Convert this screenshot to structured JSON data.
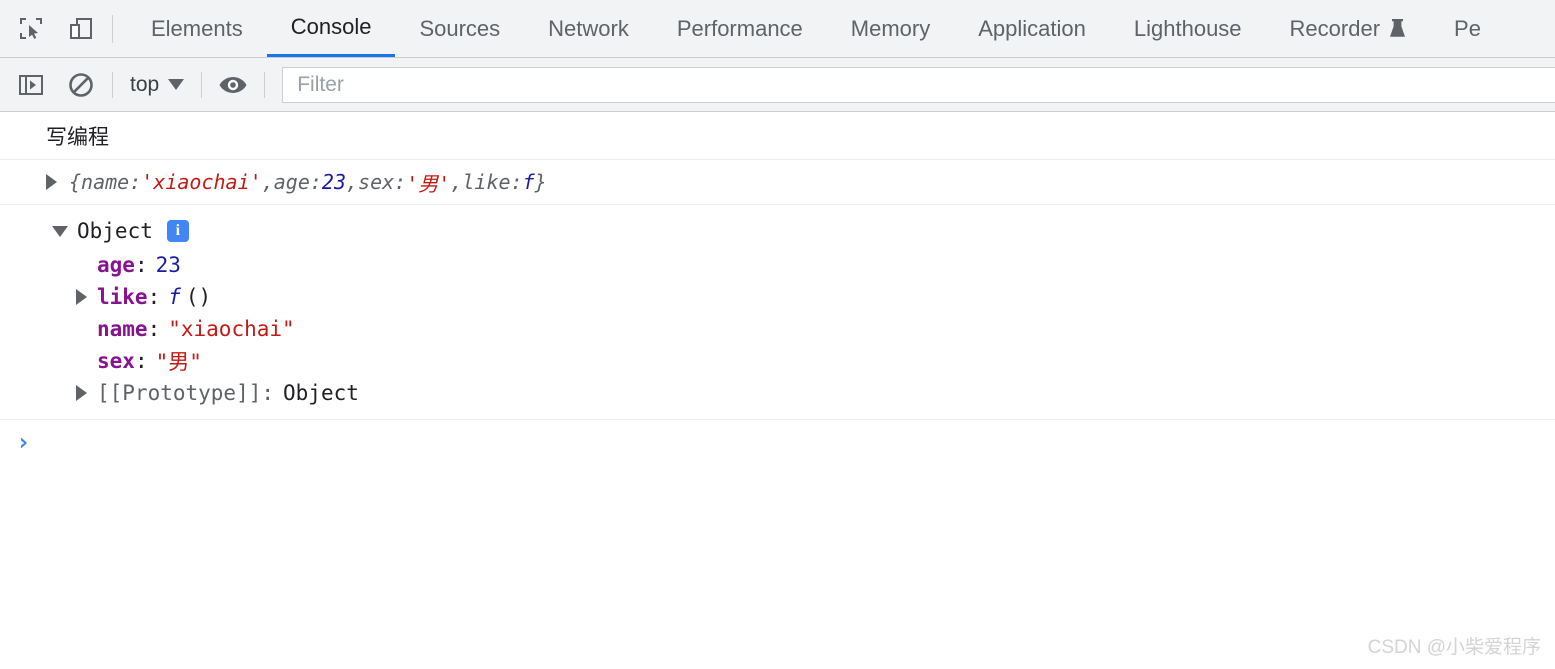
{
  "tabbar": {
    "icons": [
      {
        "name": "inspect-element-icon"
      },
      {
        "name": "device-toolbar-icon"
      }
    ],
    "tabs": [
      {
        "label": "Elements",
        "active": false
      },
      {
        "label": "Console",
        "active": true
      },
      {
        "label": "Sources",
        "active": false
      },
      {
        "label": "Network",
        "active": false
      },
      {
        "label": "Performance",
        "active": false
      },
      {
        "label": "Memory",
        "active": false
      },
      {
        "label": "Application",
        "active": false
      },
      {
        "label": "Lighthouse",
        "active": false
      },
      {
        "label": "Recorder",
        "active": false,
        "badge": "experimental-flask-icon"
      },
      {
        "label": "Pe",
        "active": false
      }
    ]
  },
  "console_toolbar": {
    "sidebar_toggle": "console-sidebar-icon",
    "clear_console": "clear-console-icon",
    "context_label": "top",
    "eye_icon": "live-expression-eye-icon",
    "filter_placeholder": "Filter",
    "filter_value": ""
  },
  "console": {
    "message_log": "写编程",
    "preview": {
      "brace_open": "{",
      "k1": "name: ",
      "v1": "'xiaochai'",
      "sep1": ", ",
      "k2": "age: ",
      "v2": "23",
      "sep2": ", ",
      "k3": "sex: ",
      "v3": "'男'",
      "sep3": ", ",
      "k4": "like: ",
      "v4": "f",
      "brace_close": "}"
    },
    "object": {
      "label": "Object",
      "info_badge": "i",
      "properties": [
        {
          "key": "age",
          "colon": ":",
          "value": "23",
          "kind": "num",
          "expandable": false
        },
        {
          "key": "like",
          "colon": ":",
          "value": "f",
          "kind": "fn",
          "paren": "()",
          "expandable": true
        },
        {
          "key": "name",
          "colon": ":",
          "value": "\"xiaochai\"",
          "kind": "str",
          "expandable": false
        },
        {
          "key": "sex",
          "colon": ":",
          "value": "\"男\"",
          "kind": "str",
          "expandable": false
        }
      ],
      "prototype_key": "[[Prototype]]:",
      "prototype_value": "Object"
    },
    "prompt_chevron": "›"
  },
  "watermark": "CSDN @小柴爱程序"
}
